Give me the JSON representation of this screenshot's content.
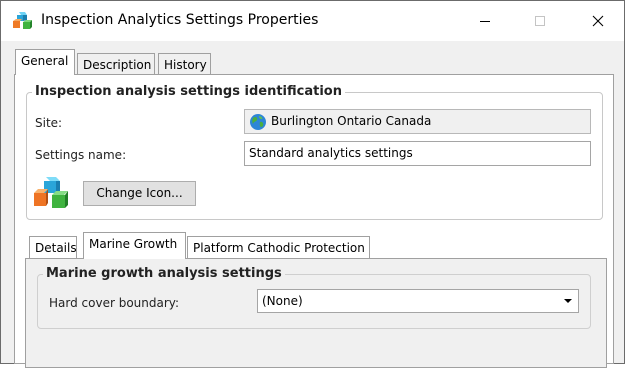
{
  "window": {
    "title": "Inspection Analytics Settings Properties"
  },
  "tabs": [
    {
      "label": "General",
      "active": true
    },
    {
      "label": "Description",
      "active": false
    },
    {
      "label": "History",
      "active": false
    }
  ],
  "identification": {
    "group_title": "Inspection analysis settings identification",
    "site_label": "Site:",
    "site_value": "Burlington Ontario Canada",
    "settings_name_label": "Settings name:",
    "settings_name_value": "Standard analytics settings",
    "change_icon_label": "Change Icon..."
  },
  "sub_tabs": [
    {
      "label": "Details",
      "active": false
    },
    {
      "label": "Marine Growth",
      "active": true
    },
    {
      "label": "Platform Cathodic Protection",
      "active": false
    }
  ],
  "marine_growth": {
    "group_title": "Marine growth analysis settings",
    "hard_cover_label": "Hard cover boundary:",
    "hard_cover_value": "(None)"
  },
  "colors": {
    "window_bg": "#f0f0f0",
    "page_bg": "#ffffff",
    "border": "#a0a0a0"
  }
}
